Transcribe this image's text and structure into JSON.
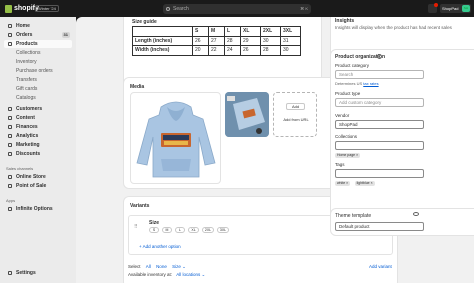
{
  "topbar": {
    "brand": "shopify",
    "edition": "Winter '24",
    "search_placeholder": "Search",
    "search_shortcut": "⌘ K",
    "store_name": "ShopPad",
    "store_initials": "SH"
  },
  "sidebar": {
    "items": [
      {
        "label": "Home"
      },
      {
        "label": "Orders",
        "badge": "31"
      },
      {
        "label": "Products"
      },
      {
        "label": "Collections"
      },
      {
        "label": "Inventory"
      },
      {
        "label": "Purchase orders"
      },
      {
        "label": "Transfers"
      },
      {
        "label": "Gift cards"
      },
      {
        "label": "Catalogs"
      },
      {
        "label": "Customers"
      },
      {
        "label": "Content"
      },
      {
        "label": "Finances"
      },
      {
        "label": "Analytics"
      },
      {
        "label": "Marketing"
      },
      {
        "label": "Discounts"
      }
    ],
    "sales_channels_title": "Sales channels",
    "sales_channels": [
      {
        "label": "Online Store"
      },
      {
        "label": "Point of Sale"
      }
    ],
    "apps_title": "Apps",
    "apps": [
      {
        "label": "Infinite Options"
      }
    ],
    "settings": "Settings"
  },
  "size_guide": {
    "title": "Size guide",
    "header": [
      "",
      "S",
      "M",
      "L",
      "XL",
      "2XL",
      "3XL"
    ],
    "rows": [
      [
        "Length (inches)",
        "26",
        "27",
        "28",
        "29",
        "30",
        "31"
      ],
      [
        "Width (inches)",
        "20",
        "22",
        "24",
        "26",
        "28",
        "30"
      ]
    ]
  },
  "media": {
    "title": "Media",
    "add_label": "Add",
    "add_from_url": "Add from URL"
  },
  "variants": {
    "title": "Variants",
    "option_name": "Size",
    "option_values": [
      "S",
      "M",
      "L",
      "XL",
      "2XL",
      "3XL"
    ],
    "edit_label": "Edit",
    "add_option": "+ Add another option",
    "select_label": "Select",
    "select_all": "All",
    "select_none": "None",
    "select_size": "Size ⌄",
    "add_variant": "Add variant",
    "available_inventory": "Available inventory at:",
    "all_locations": "All locations ⌄"
  },
  "insights": {
    "title": "Insights",
    "text": "Insights will display when the product has had recent sales"
  },
  "org": {
    "title": "Product organization",
    "category_label": "Product category",
    "category_placeholder": "Search",
    "category_help_prefix": "Determines US",
    "category_help_link": "tax rates",
    "type_label": "Product type",
    "type_placeholder": "Add custom category",
    "vendor_label": "Vendor",
    "vendor_value": "ShopPad",
    "collections_label": "Collections",
    "collections_tags": [
      "Home page ×"
    ],
    "tags_label": "Tags",
    "tags": [
      "white ×",
      "lightblue ×"
    ]
  },
  "theme": {
    "title": "Theme template",
    "value": "Default product"
  }
}
